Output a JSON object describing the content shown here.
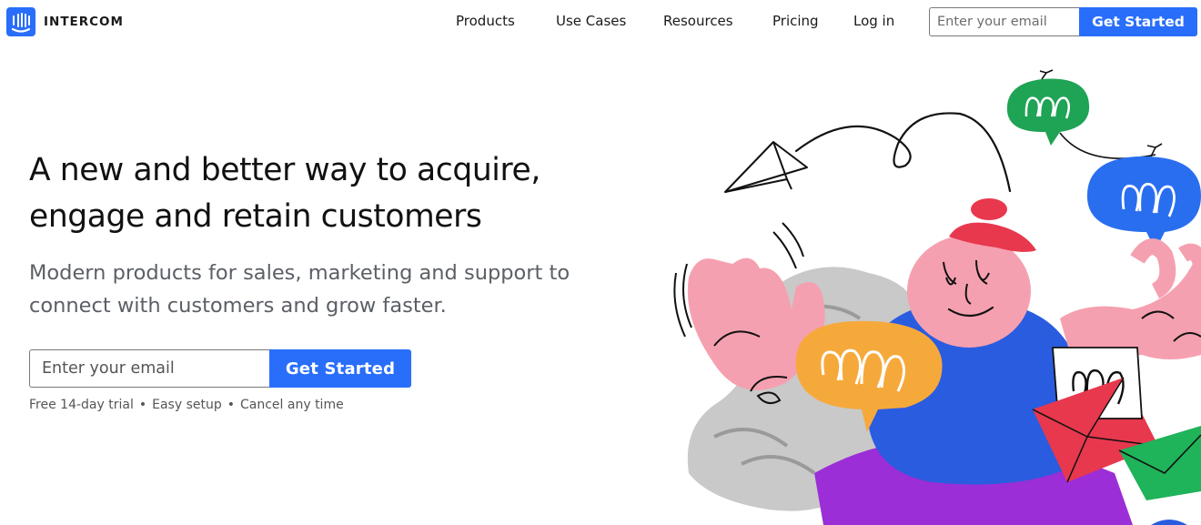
{
  "brand": {
    "name": "INTERCOM",
    "color": "#286efa"
  },
  "nav": {
    "items": [
      {
        "label": "Products"
      },
      {
        "label": "Use Cases"
      },
      {
        "label": "Resources"
      },
      {
        "label": "Pricing"
      },
      {
        "label": "Log in"
      }
    ]
  },
  "header_form": {
    "placeholder": "Enter your email",
    "button_label": "Get Started"
  },
  "hero": {
    "title_line1": "A new and better way to acquire,",
    "title_line2": "engage and retain customers",
    "subtitle_line1": "Modern products for sales, marketing and support to",
    "subtitle_line2": "connect with customers and grow faster.",
    "placeholder": "Enter your email",
    "button_label": "Get Started",
    "features": [
      "Free 14-day trial",
      "Easy setup",
      "Cancel any time"
    ],
    "feature_separator": "•"
  },
  "illustration": {
    "icons": [
      "paper-plane-icon",
      "chat-bubble-icon",
      "envelope-icon",
      "character-icon"
    ],
    "colors": {
      "skin": "#f5a0b0",
      "shirt": "#2a5ce0",
      "pants": "#9b2ed6",
      "hat": "#e8384e",
      "bubble_orange": "#f6a93b",
      "bubble_green": "#1fa354",
      "bubble_blue": "#2a6ef0",
      "envelope_red": "#e8384e",
      "envelope_green": "#1fb35a"
    }
  }
}
